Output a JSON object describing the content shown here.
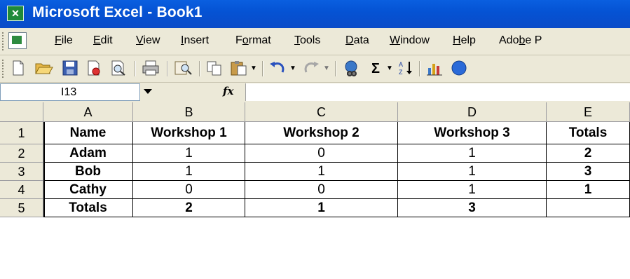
{
  "window": {
    "title": "Microsoft Excel - Book1"
  },
  "menu": [
    {
      "label": "File"
    },
    {
      "label": "Edit"
    },
    {
      "label": "View"
    },
    {
      "label": "Insert"
    },
    {
      "label": "Format"
    },
    {
      "label": "Tools"
    },
    {
      "label": "Data"
    },
    {
      "label": "Window"
    },
    {
      "label": "Help"
    },
    {
      "label": "Adobe P"
    }
  ],
  "toolbar": {
    "icons": [
      "new-icon",
      "open-icon",
      "save-icon",
      "permission-icon",
      "print-preview-icon",
      "print-icon",
      "research-icon",
      "copy-icon",
      "paste-icon",
      "paste-dropdown-icon",
      "undo-icon",
      "undo-dropdown-icon",
      "redo-icon",
      "redo-dropdown-icon",
      "hyperlink-icon",
      "autosum-icon",
      "autosum-dropdown-icon",
      "sort-ascending-icon",
      "chart-wizard-icon",
      "help-icon"
    ],
    "autosum_glyph": "Σ"
  },
  "formula_bar": {
    "name_box": "I13",
    "fx": "fx",
    "formula": ""
  },
  "sheet": {
    "columns": [
      "A",
      "B",
      "C",
      "D",
      "E"
    ],
    "rows": [
      {
        "num": "1",
        "cells": [
          "Name",
          "Workshop 1",
          "Workshop 2",
          "Workshop 3",
          "Totals"
        ]
      },
      {
        "num": "2",
        "cells": [
          "Adam",
          "1",
          "0",
          "1",
          "2"
        ]
      },
      {
        "num": "3",
        "cells": [
          "Bob",
          "1",
          "1",
          "1",
          "3"
        ]
      },
      {
        "num": "4",
        "cells": [
          "Cathy",
          "0",
          "0",
          "1",
          "1"
        ]
      },
      {
        "num": "5",
        "cells": [
          "Totals",
          "2",
          "1",
          "3",
          ""
        ]
      }
    ]
  }
}
